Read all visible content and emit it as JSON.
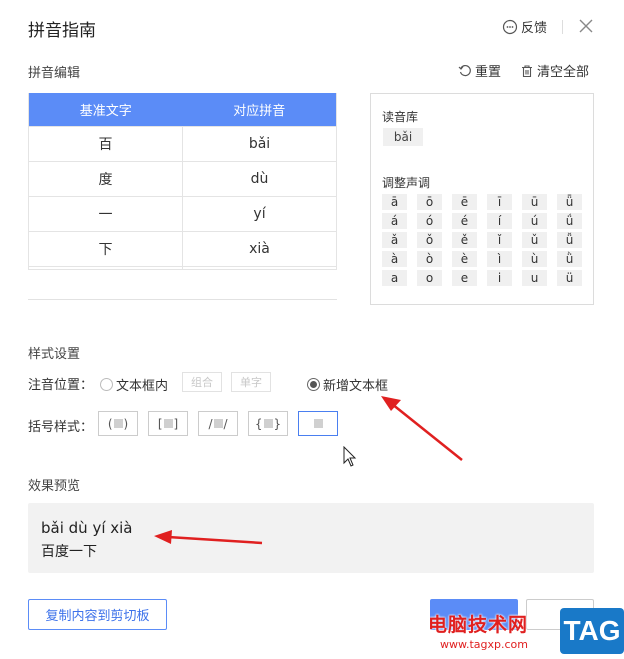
{
  "dialog": {
    "title": "拼音指南",
    "feedback_label": "反馈"
  },
  "pinyin_edit": {
    "label": "拼音编辑",
    "reset_label": "重置",
    "clear_label": "清空全部",
    "columns": [
      "基准文字",
      "对应拼音"
    ],
    "rows": [
      [
        "百",
        "bǎi"
      ],
      [
        "度",
        "dù"
      ],
      [
        "一",
        "yí"
      ],
      [
        "下",
        "xià"
      ]
    ]
  },
  "reading_lib": {
    "label": "读音库",
    "chip": "bǎi",
    "tone_label": "调整声调",
    "tones": [
      "ā",
      "ō",
      "ē",
      "ī",
      "ū",
      "ǖ",
      "á",
      "ó",
      "é",
      "í",
      "ú",
      "ǘ",
      "ǎ",
      "ǒ",
      "ě",
      "ǐ",
      "ǔ",
      "ǚ",
      "à",
      "ò",
      "è",
      "ì",
      "ù",
      "ǜ",
      "a",
      "o",
      "e",
      "i",
      "u",
      "ü"
    ]
  },
  "style_settings": {
    "label": "样式设置",
    "position_label": "注音位置：",
    "opt_in_box": "文本框内",
    "btn_combine": "组合",
    "btn_single": "单字",
    "opt_new_box": "新增文本框",
    "bracket_label": "括号样式："
  },
  "preview": {
    "label": "效果预览",
    "line1": "bǎi dù yí xià",
    "line2": "百度一下"
  },
  "footer": {
    "copy_label": "复制内容到剪切板"
  },
  "watermark": {
    "site_name": "电脑技术网",
    "url": "www.tagxp.com",
    "tag": "TAG"
  },
  "colors": {
    "accent": "#5b8cf7",
    "arrow": "#e02020"
  }
}
